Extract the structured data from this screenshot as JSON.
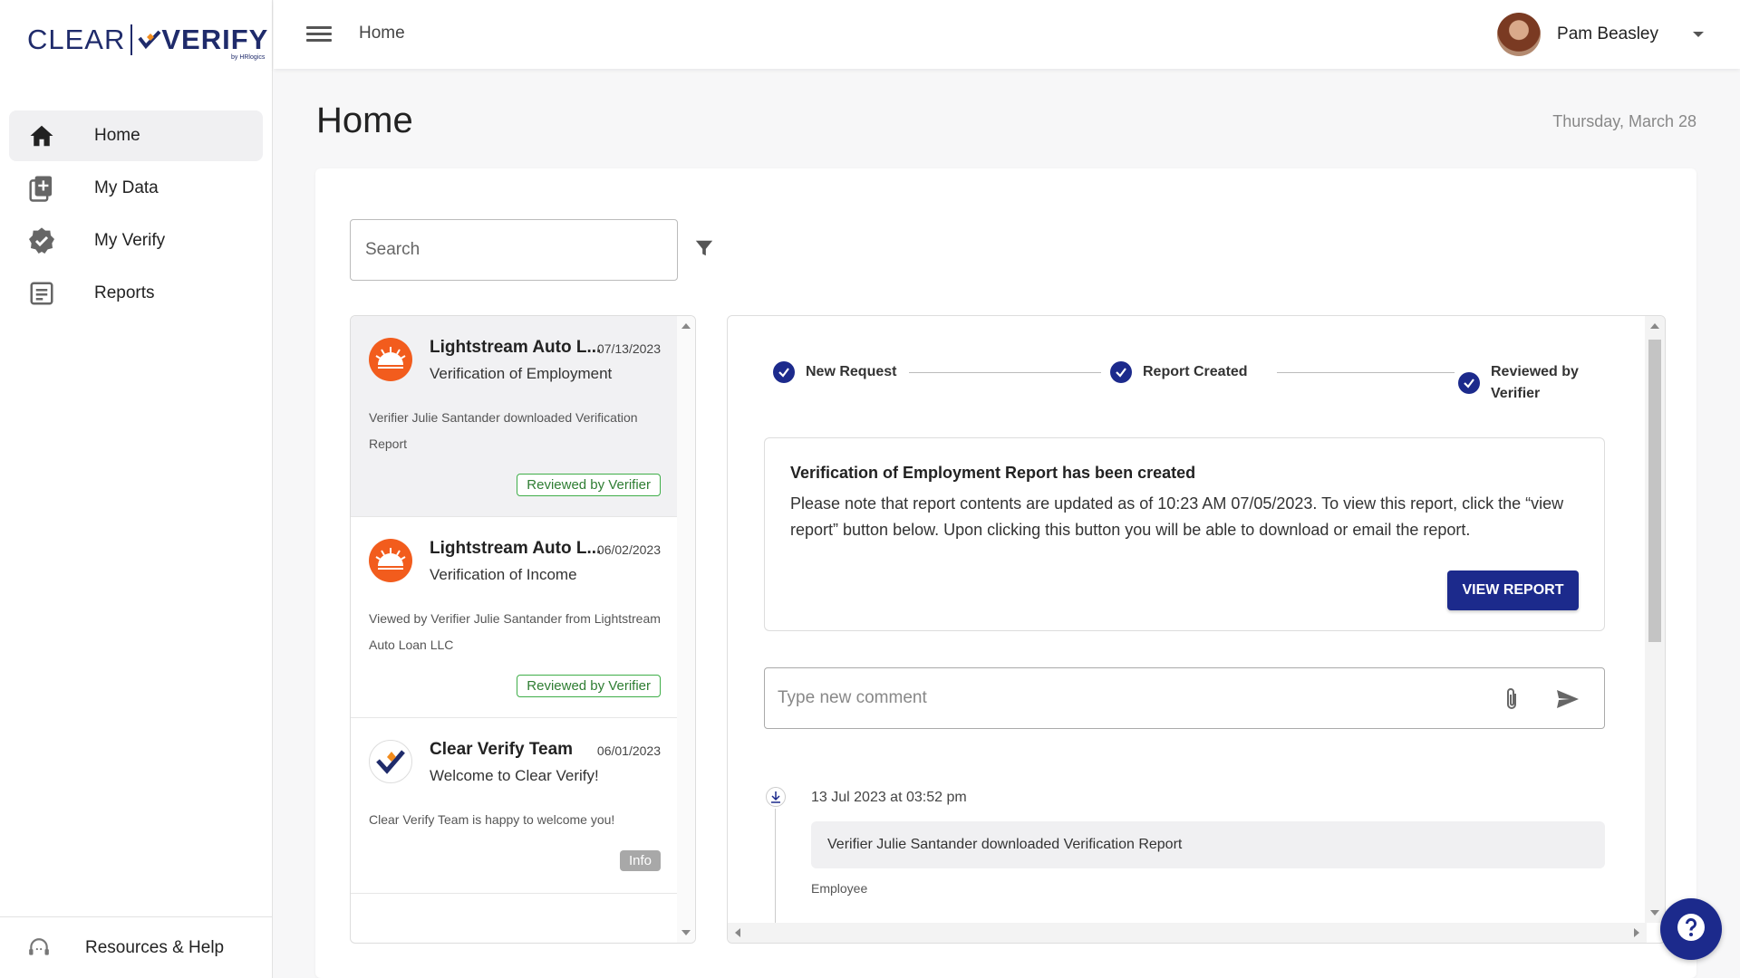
{
  "app": {
    "logo_left": "CLEAR",
    "logo_right": "VERIFY",
    "logo_by": "by HRlogics"
  },
  "sidebar": {
    "items": [
      {
        "label": "Home",
        "icon": "home-icon",
        "active": true
      },
      {
        "label": "My Data",
        "icon": "my-data-icon",
        "active": false
      },
      {
        "label": "My Verify",
        "icon": "verified-badge-icon",
        "active": false
      },
      {
        "label": "Reports",
        "icon": "reports-icon",
        "active": false
      }
    ],
    "footer_label": "Resources & Help"
  },
  "topbar": {
    "breadcrumb": "Home",
    "user_name": "Pam Beasley"
  },
  "page": {
    "title": "Home",
    "date": "Thursday, March 28"
  },
  "search": {
    "placeholder": "Search"
  },
  "list": {
    "items": [
      {
        "title": "Lightstream Auto L...",
        "date": "07/13/2023",
        "subtitle": "Verification of Employment",
        "description": "Verifier Julie Santander downloaded Verification Report",
        "badge": "Reviewed by Verifier",
        "badge_type": "green"
      },
      {
        "title": "Lightstream Auto L...",
        "date": "06/02/2023",
        "subtitle": "Verification of Income",
        "description": "Viewed by Verifier Julie Santander from Lightstream Auto Loan LLC",
        "badge": "Reviewed by Verifier",
        "badge_type": "green"
      },
      {
        "title": "Clear Verify Team",
        "date": "06/01/2023",
        "subtitle": "Welcome to Clear Verify!",
        "description": "Clear Verify Team is happy to welcome you!",
        "badge": "Info",
        "badge_type": "gray"
      }
    ]
  },
  "detail": {
    "steps": [
      "New Request",
      "Report Created",
      "Reviewed by Verifier"
    ],
    "notice_title": "Verification of Employment Report has been created",
    "notice_body": "Please note that report contents are updated as of 10:23 AM 07/05/2023. To view this report, click the “view report” button below. Upon clicking this button you will be able to download or email the report.",
    "view_report_label": "VIEW REPORT",
    "comment_placeholder": "Type new comment",
    "timeline": {
      "time": "13 Jul 2023 at 03:52 pm",
      "message": "Verifier Julie Santander downloaded Verification Report",
      "role": "Employee"
    }
  },
  "colors": {
    "brand_navy": "#1c2a8c",
    "brand_orange": "#f25c1d",
    "badge_green": "#3fae49"
  }
}
